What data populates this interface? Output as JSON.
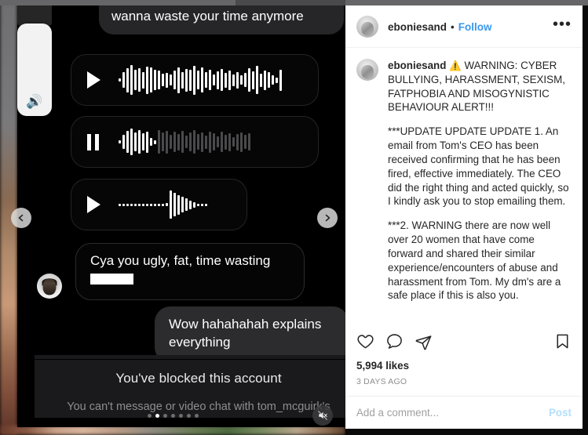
{
  "post": {
    "username": "eboniesand",
    "separator": "•",
    "follow_label": "Follow",
    "more_options_label": "•••",
    "likes": "5,994 likes",
    "timestamp": "3 DAYS AGO"
  },
  "caption": {
    "author": "eboniesand",
    "warning_emoji": "⚠️",
    "paragraph_1": " WARNING: CYBER BULLYING, HARASSMENT, SEXISM, FATPHOBIA AND MISOGYNISTIC BEHAVIOUR ALERT!!!",
    "paragraph_2": "***UPDATE UPDATE UPDATE 1. An email from Tom's CEO has been received confirming that he has been fired, effective immediately. The CEO did the right thing and acted quickly, so I kindly ask you to stop emailing them.",
    "paragraph_3": "***2. WARNING there are now well over 20 women that have come forward and shared their similar experience/encounters of abuse and harassment from Tom. My dm's are a safe place if this is also you."
  },
  "actions": {
    "like_icon": "heart-icon",
    "comment_icon": "comment-bubble-icon",
    "share_icon": "share-paper-plane-icon",
    "save_icon": "bookmark-icon"
  },
  "comment_box": {
    "placeholder": "Add a comment...",
    "post_label": "Post"
  },
  "media": {
    "bubble_clipped_top": "wanna waste your time anymore",
    "bubble_cya": "Cya you ugly, fat, time wasting",
    "bubble_wow": "Wow hahahahah explains everything",
    "blocked_title": "You've blocked this account",
    "blocked_subtitle": "You can't message or video chat with tom_mcguirk's",
    "volume_icon": "speaker-volume-icon",
    "mute_icon": "speaker-muted-icon",
    "prev_icon": "chevron-left-icon",
    "next_icon": "chevron-right-icon",
    "audio_messages": [
      {
        "state": "play",
        "control_icon": "play-icon"
      },
      {
        "state": "pause",
        "control_icon": "pause-icon"
      },
      {
        "state": "play",
        "control_icon": "play-icon"
      }
    ],
    "carousel": {
      "total": 7,
      "active_index": 1
    }
  },
  "colors": {
    "accent_blue": "#3897f0",
    "post_disabled": "#b2dffc",
    "text_primary": "#262626",
    "text_muted": "#8e8e8e",
    "media_bg": "#000000"
  }
}
